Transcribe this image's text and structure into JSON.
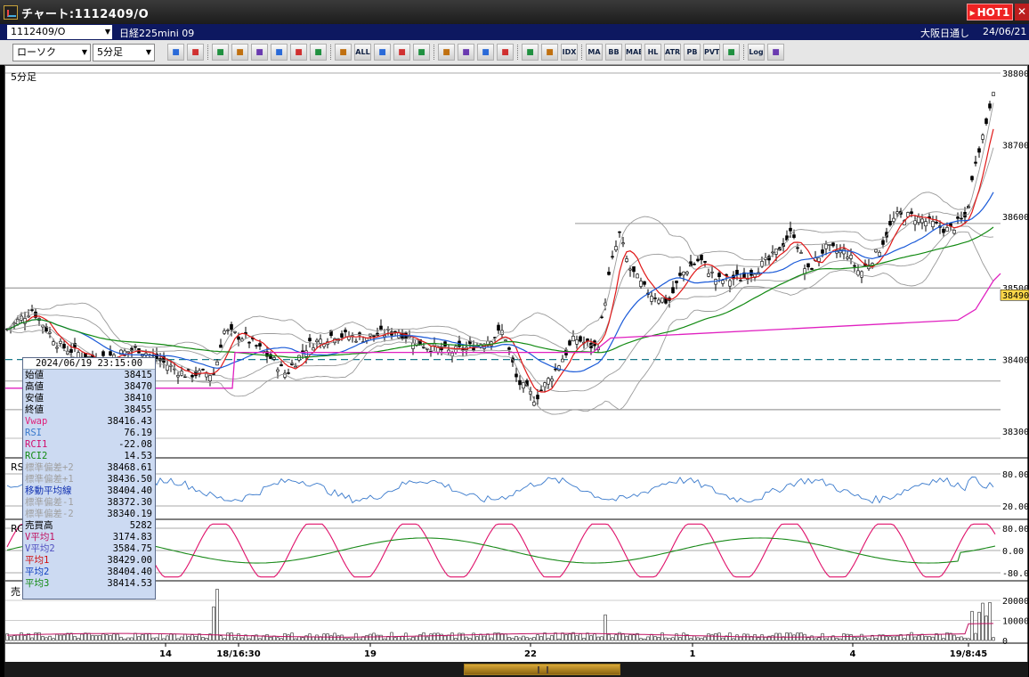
{
  "window": {
    "title": "チャート:1112409/O",
    "hot_label": "HOT1",
    "close_label": "✕"
  },
  "symbol_bar": {
    "symbol": "1112409/O",
    "name": "日経225mini 09",
    "session": "大阪日通し",
    "date": "24/06/21"
  },
  "toolbar": {
    "chart_type": "ローソク",
    "interval": "5分足",
    "buttons": [
      "search",
      "layout",
      "candle-a",
      "candle-b",
      "bar",
      "line",
      "bolt",
      "open-left",
      "open-right",
      "all",
      "pen",
      "trend",
      "cursor",
      "undo",
      "note",
      "trash",
      "grid",
      "wrench",
      "palette",
      "idx",
      "ma",
      "bb",
      "mae",
      "hl",
      "atr",
      "pnb",
      "pvt",
      "box",
      "log",
      "export"
    ],
    "labels": {
      "all": "ALL",
      "idx": "IDX",
      "ma": "MA",
      "bb": "BB",
      "mae": "MAE",
      "hl": "HL",
      "atr": "ATR",
      "pnb": "PB",
      "pvt": "PVT",
      "log": "Log"
    }
  },
  "panes": {
    "price_label": "5分足",
    "rsi_label": "RS",
    "rci_label": "RC",
    "volume_label": "売"
  },
  "price_axis": {
    "ticks": [
      "38800",
      "38700",
      "38600",
      "38500",
      "38400",
      "38300"
    ],
    "current": "38490"
  },
  "rsi_axis": {
    "ticks": [
      "80.00",
      "20.00"
    ]
  },
  "rci_axis": {
    "ticks": [
      "80.00",
      "0.00",
      "-80.00"
    ]
  },
  "vol_axis": {
    "ticks": [
      "20000",
      "10000",
      "0"
    ]
  },
  "time_axis": {
    "labels": [
      "14",
      "18/16:30",
      "19",
      "22",
      "1",
      "4",
      "19/8:45"
    ]
  },
  "infobox": {
    "header": "2024/06/19  23:15:00",
    "rows": [
      {
        "label": "始値",
        "value": "38415",
        "color": "#000000"
      },
      {
        "label": "高値",
        "value": "38470",
        "color": "#000000"
      },
      {
        "label": "安値",
        "value": "38410",
        "color": "#000000"
      },
      {
        "label": "終値",
        "value": "38455",
        "color": "#000000"
      },
      {
        "label": "Vwap",
        "value": "38416.43",
        "color": "#e0207a"
      },
      {
        "label": "RSI",
        "value": "76.19",
        "color": "#3a7acc"
      },
      {
        "label": "RCI1",
        "value": "-22.08",
        "color": "#d01070"
      },
      {
        "label": "RCI2",
        "value": "14.53",
        "color": "#128a12"
      },
      {
        "label": "標準偏差+2",
        "value": "38468.61",
        "color": "#a0a0a0"
      },
      {
        "label": "標準偏差+1",
        "value": "38436.50",
        "color": "#a0a0a0"
      },
      {
        "label": "移動平均線",
        "value": "38404.40",
        "color": "#1030b0"
      },
      {
        "label": "標準偏差-1",
        "value": "38372.30",
        "color": "#a0a0a0"
      },
      {
        "label": "標準偏差-2",
        "value": "38340.19",
        "color": "#a0a0a0"
      },
      {
        "label": "売買高",
        "value": "5282",
        "color": "#000000"
      },
      {
        "label": "V平均1",
        "value": "3174.83",
        "color": "#c01060"
      },
      {
        "label": "V平均2",
        "value": "3584.75",
        "color": "#5050c0"
      },
      {
        "label": "平均1",
        "value": "38429.00",
        "color": "#d01010"
      },
      {
        "label": "平均2",
        "value": "38404.40",
        "color": "#1040c0"
      },
      {
        "label": "平均3",
        "value": "38414.53",
        "color": "#128a12"
      }
    ]
  },
  "colors": {
    "ma_short": "#e01818",
    "ma_mid": "#1a5ad8",
    "ma_long": "#128a12",
    "vwap": "#e020c0",
    "band": "#9a9a9a",
    "rsi": "#3a7acc",
    "rci1": "#e0106a",
    "rci2": "#1a8a1a",
    "current_price_bg": "#ffd84a"
  }
}
